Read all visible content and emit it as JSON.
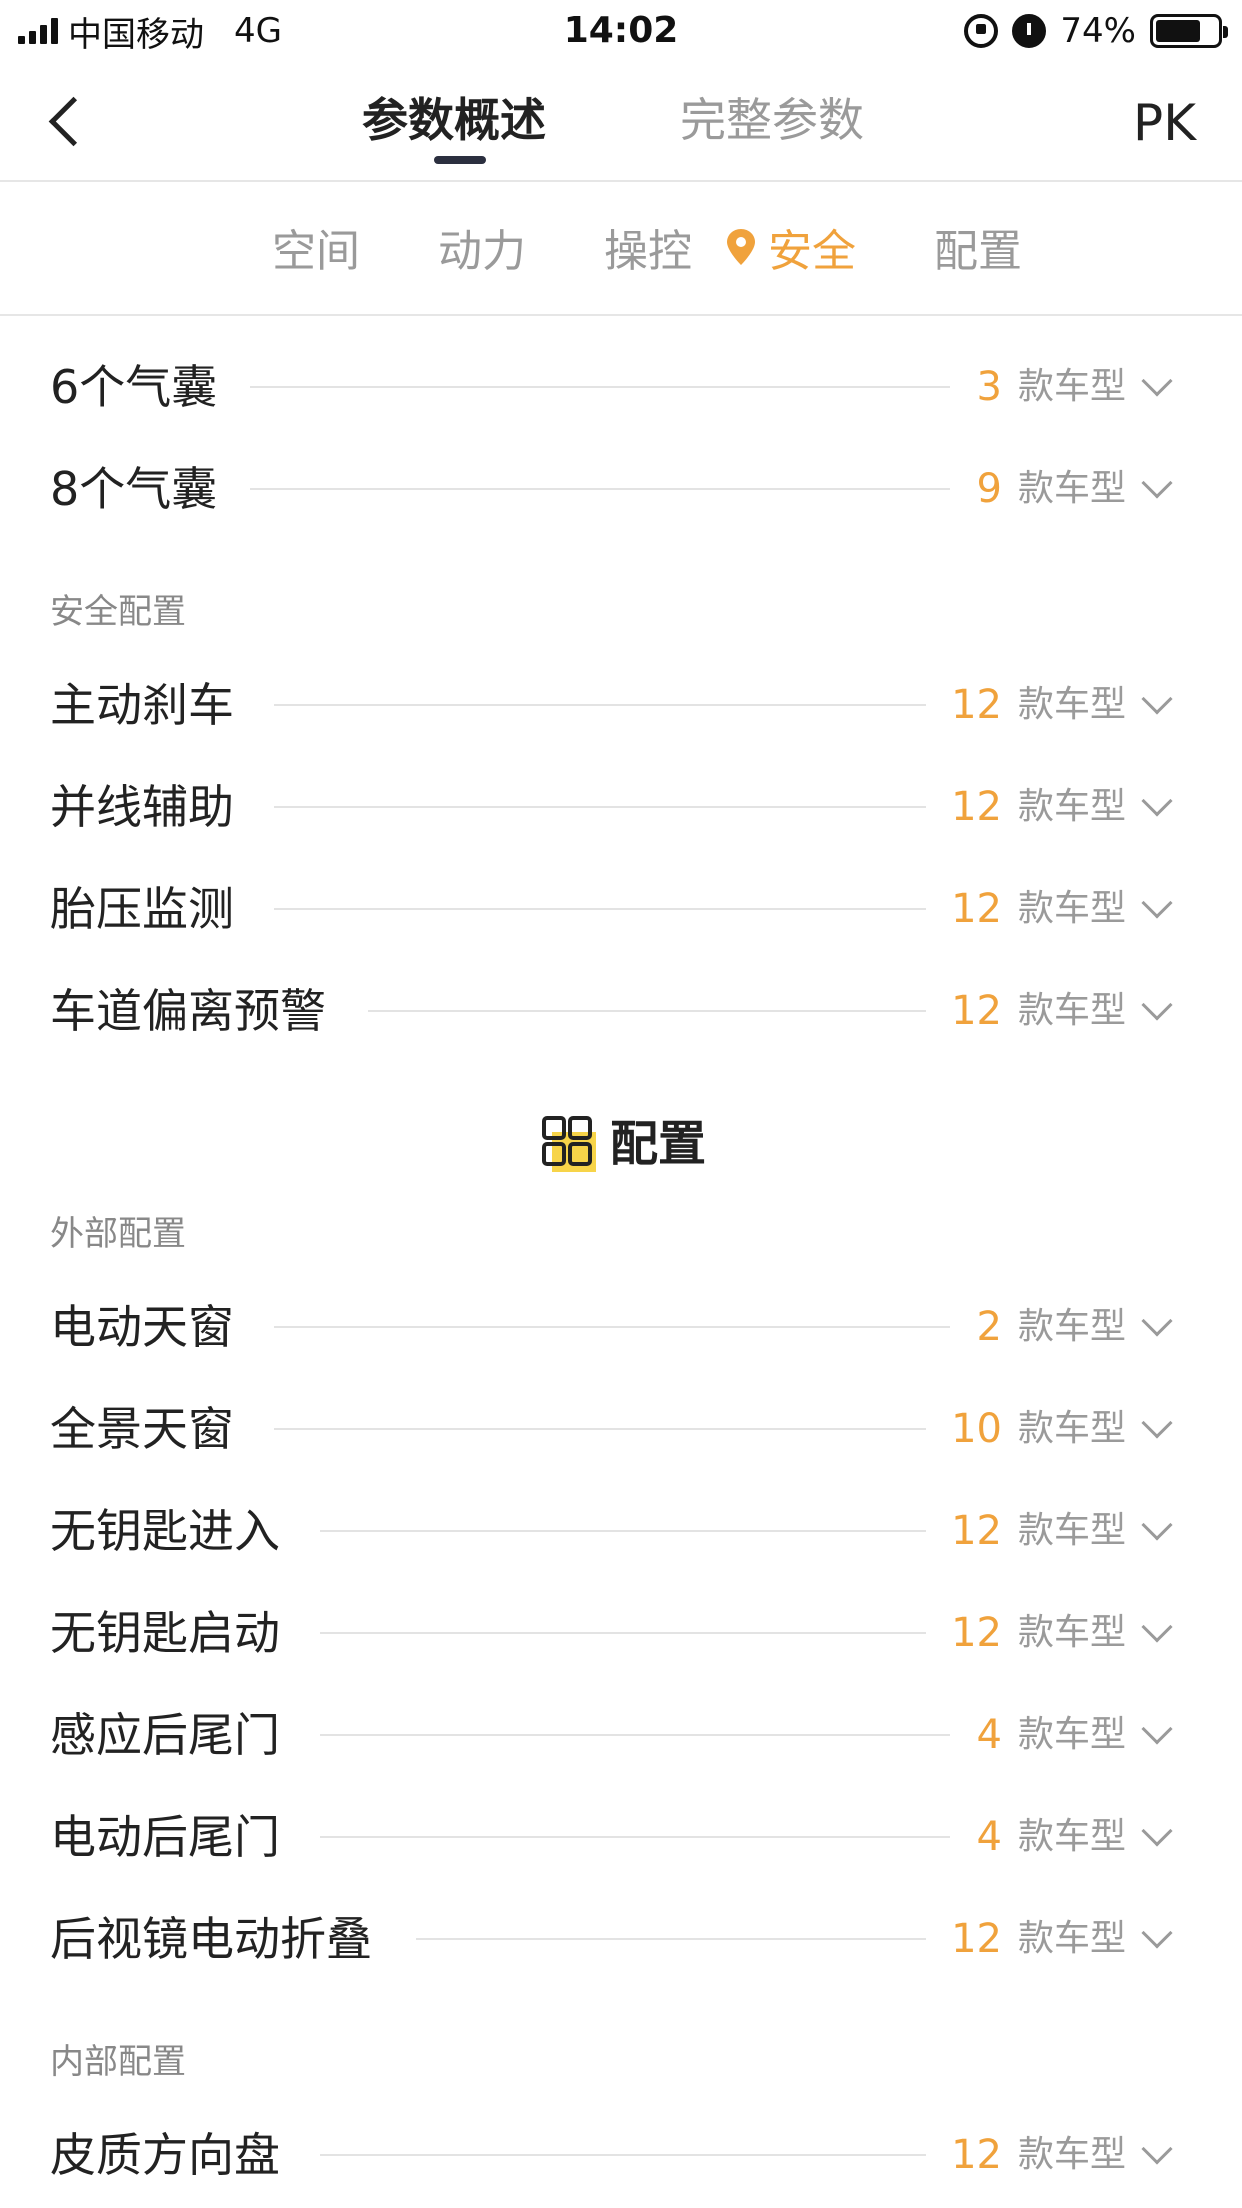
{
  "status_bar": {
    "carrier": "中国移动",
    "network": "4G",
    "time": "14:02",
    "battery_percent": "74%",
    "battery_level": 0.74
  },
  "nav": {
    "tabs": [
      {
        "label": "参数概述",
        "active": true
      },
      {
        "label": "完整参数",
        "active": false
      }
    ],
    "pk_label": "PK"
  },
  "subnav": {
    "items": [
      {
        "label": "空间",
        "active": false
      },
      {
        "label": "动力",
        "active": false
      },
      {
        "label": "操控",
        "active": false
      },
      {
        "label": "安全",
        "active": true
      },
      {
        "label": "配置",
        "active": false
      }
    ]
  },
  "unit_label": "款车型",
  "safety": {
    "airbag_rows": [
      {
        "label": "6个气囊",
        "count": "3"
      },
      {
        "label": "8个气囊",
        "count": "9"
      }
    ],
    "group_label": "安全配置",
    "rows": [
      {
        "label": "主动刹车",
        "count": "12"
      },
      {
        "label": "并线辅助",
        "count": "12"
      },
      {
        "label": "胎压监测",
        "count": "12"
      },
      {
        "label": "车道偏离预警",
        "count": "12"
      }
    ]
  },
  "config": {
    "title": "配置",
    "exterior_label": "外部配置",
    "exterior_rows": [
      {
        "label": "电动天窗",
        "count": "2"
      },
      {
        "label": "全景天窗",
        "count": "10"
      },
      {
        "label": "无钥匙进入",
        "count": "12"
      },
      {
        "label": "无钥匙启动",
        "count": "12"
      },
      {
        "label": "感应后尾门",
        "count": "4"
      },
      {
        "label": "电动后尾门",
        "count": "4"
      },
      {
        "label": "后视镜电动折叠",
        "count": "12"
      }
    ],
    "interior_label": "内部配置",
    "interior_rows": [
      {
        "label": "皮质方向盘",
        "count": "12"
      }
    ]
  },
  "colors": {
    "accent": "#f0a23c",
    "text": "#222222",
    "muted": "#9a9a9a",
    "divider": "#e3e3e3",
    "tab_underline": "#2b2f3f",
    "icon_yellow": "#f7d449"
  }
}
